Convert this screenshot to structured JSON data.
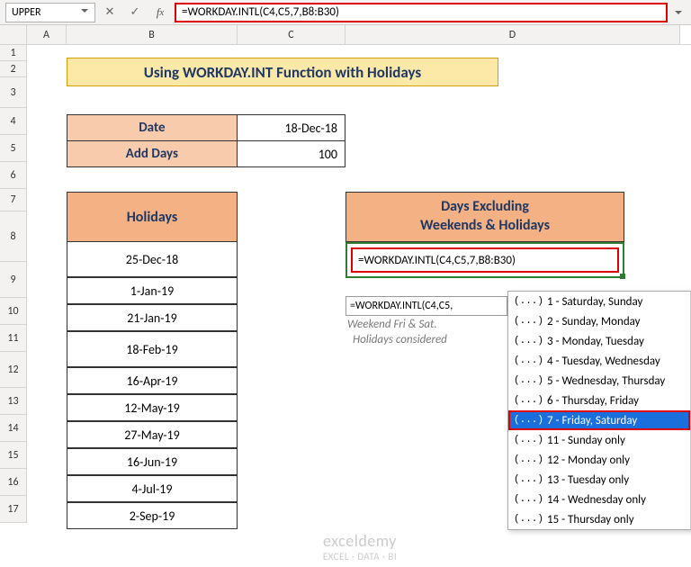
{
  "namebox": {
    "value": "UPPER"
  },
  "formula_bar": {
    "value": "=WORKDAY.INTL(C4,C5,7,B8:B30)"
  },
  "columns": {
    "A": "A",
    "B": "B",
    "C": "C",
    "D": "D"
  },
  "row_labels": [
    "1",
    "2",
    "3",
    "4",
    "5",
    "6",
    "7",
    "8",
    "9",
    "10",
    "11",
    "12",
    "13",
    "14",
    "15",
    "16",
    "17"
  ],
  "title": "Using WORKDAY.INT Function with Holidays",
  "input_table": {
    "rows": [
      {
        "label": "Date",
        "value": "18-Dec-18"
      },
      {
        "label": "Add Days",
        "value": "100"
      }
    ]
  },
  "holidays": {
    "header": "Holidays",
    "items": [
      "25-Dec-18",
      "1-Jan-19",
      "21-Jan-19",
      "18-Feb-19",
      "16-Apr-19",
      "12-May-19",
      "27-May-19",
      "16-Jun-19",
      "4-Jul-19",
      "2-Sep-19"
    ]
  },
  "days_header": "Days Excluding\nWeekends & Holidays",
  "active_formula": "=WORKDAY.INTL(C4,C5,7,B8:B30)",
  "tooltip": {
    "partial": "=WORKDAY.INTL(C4,C5,",
    "hint1": "Weekend Fri & Sat.",
    "hint2": "Holidays considered"
  },
  "dropdown": {
    "items": [
      "1 - Saturday, Sunday",
      "2 - Sunday, Monday",
      "3 - Monday, Tuesday",
      "4 - Tuesday, Wednesday",
      "5 - Wednesday, Thursday",
      "6 - Thursday, Friday",
      "7 - Friday, Saturday",
      "11 - Sunday only",
      "12 - Monday only",
      "13 - Tuesday only",
      "14 - Wednesday only",
      "15 - Thursday only"
    ],
    "selected_index": 6
  },
  "watermark": {
    "line1": "exceldemy",
    "line2": "EXCEL · DATA · BI"
  }
}
